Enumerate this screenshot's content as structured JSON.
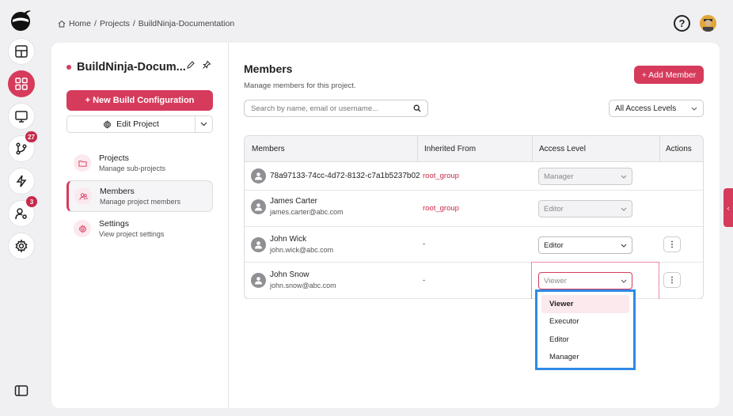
{
  "breadcrumb": {
    "home": "Home",
    "sep1": "/",
    "projects": "Projects",
    "sep2": "/",
    "current": "BuildNinja-Documentation"
  },
  "rail": {
    "git_badge": "27",
    "users_badge": "3"
  },
  "project": {
    "name": "BuildNinja-Docum..."
  },
  "actions": {
    "new_build_config": "+ New Build Configuration",
    "edit_project": "Edit Project"
  },
  "nav": [
    {
      "title": "Projects",
      "subtitle": "Manage sub-projects"
    },
    {
      "title": "Members",
      "subtitle": "Manage project members"
    },
    {
      "title": "Settings",
      "subtitle": "View project settings"
    }
  ],
  "members": {
    "title": "Members",
    "subtitle": "Manage members for this project.",
    "add_button": "+ Add Member",
    "search_placeholder": "Search by name, email or username...",
    "filter": "All Access Levels",
    "columns": {
      "members": "Members",
      "inherited": "Inherited From",
      "access": "Access Level",
      "actions": "Actions"
    },
    "rows": [
      {
        "name": "78a97133-74cc-4d72-8132-c7a1b5237b02",
        "email": "",
        "inherited": "root_group",
        "access": "Manager"
      },
      {
        "name": "James Carter",
        "email": "james.carter@abc.com",
        "inherited": "root_group",
        "access": "Editor"
      },
      {
        "name": "John Wick",
        "email": "john.wick@abc.com",
        "inherited": "-",
        "access": "Editor"
      },
      {
        "name": "John Snow",
        "email": "john.snow@abc.com",
        "inherited": "-",
        "access": "Viewer"
      }
    ]
  },
  "dropdown": {
    "options": [
      "Viewer",
      "Executor",
      "Editor",
      "Manager"
    ],
    "selected": "Viewer"
  },
  "colors": {
    "accent": "#d63b5c",
    "dropdown_outline": "#2e8ae6"
  }
}
